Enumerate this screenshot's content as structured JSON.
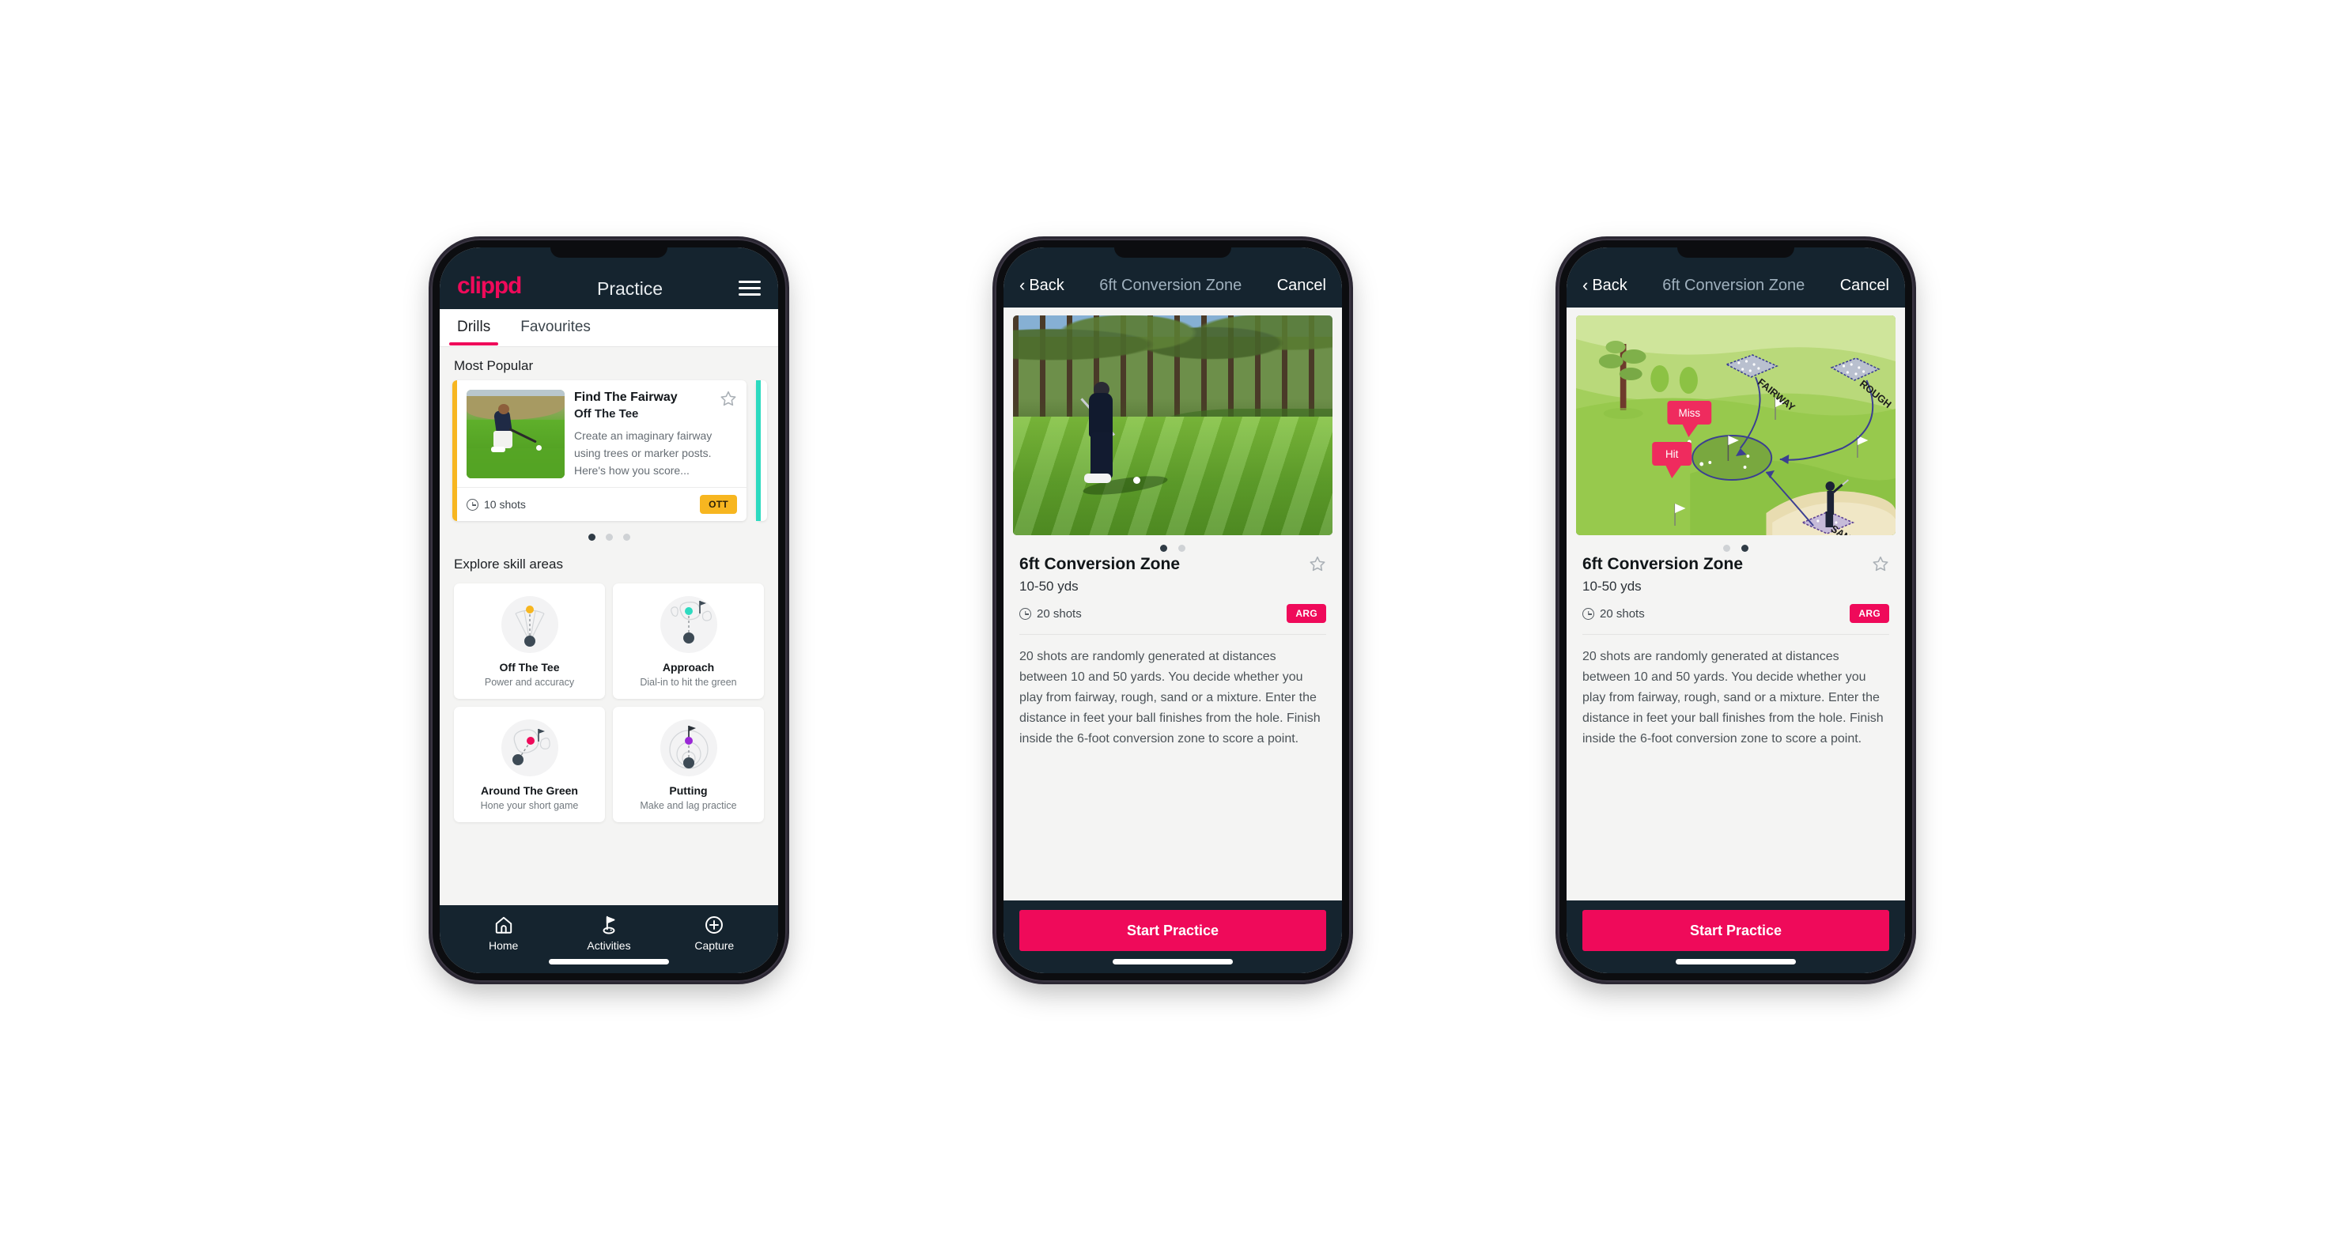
{
  "phone1": {
    "appbar": {
      "brand": "clippd",
      "title": "Practice",
      "menu_icon": "hamburger-menu-icon"
    },
    "tabs": [
      {
        "label": "Drills",
        "active": true
      },
      {
        "label": "Favourites",
        "active": false
      }
    ],
    "section_title": "Most Popular",
    "drill_card": {
      "name": "Find The Fairway",
      "category": "Off The Tee",
      "description": "Create an imaginary fairway using trees or marker posts. Here's how you score...",
      "shots": "10 shots",
      "pill": "OTT",
      "accent_color": "#f7b620",
      "next_accent_color": "#2ddac0",
      "star_icon": "star-outline-icon",
      "clock_icon": "clock-icon"
    },
    "carousel_dots": {
      "count": 3,
      "active": 0
    },
    "skills_title": "Explore skill areas",
    "skills": [
      {
        "name": "Off The Tee",
        "sub": "Power and accuracy",
        "icon": "tee-fan-icon",
        "dot_color": "#f7b620"
      },
      {
        "name": "Approach",
        "sub": "Dial-in to hit the green",
        "icon": "approach-green-icon",
        "dot_color": "#2ddac0"
      },
      {
        "name": "Around The Green",
        "sub": "Hone your short game",
        "icon": "around-green-icon",
        "dot_color": "#ef0a5a"
      },
      {
        "name": "Putting",
        "sub": "Make and lag practice",
        "icon": "putting-rings-icon",
        "dot_color": "#9a27d6"
      }
    ],
    "bottom_nav": [
      {
        "label": "Home",
        "icon": "home-icon",
        "active": false
      },
      {
        "label": "Activities",
        "icon": "golf-flag-icon",
        "active": true
      },
      {
        "label": "Capture",
        "icon": "plus-circle-icon",
        "active": false
      }
    ]
  },
  "phone2": {
    "nav": {
      "back": "Back",
      "title": "6ft Conversion Zone",
      "cancel": "Cancel",
      "back_icon": "chevron-left-icon"
    },
    "media_kind": "photo-golfer-chipping",
    "carousel_dots": {
      "count": 2,
      "active": 0
    },
    "detail": {
      "title": "6ft Conversion Zone",
      "distance": "10-50 yds",
      "shots": "20 shots",
      "pill": "ARG",
      "star_icon": "star-outline-icon",
      "clock_icon": "clock-icon",
      "description": "20 shots are randomly generated at distances between 10 and 50 yards. You decide whether you play from fairway, rough, sand or a mixture. Enter the distance in feet your ball finishes from the hole. Finish inside the 6-foot conversion zone to score a point."
    },
    "cta": "Start Practice"
  },
  "phone3": {
    "nav": {
      "back": "Back",
      "title": "6ft Conversion Zone",
      "cancel": "Cancel",
      "back_icon": "chevron-left-icon"
    },
    "media_kind": "diagram-course-map",
    "diagram_labels": {
      "fairway": "FAIRWAY",
      "rough": "ROUGH",
      "sand": "SAND",
      "miss": "Miss",
      "hit": "Hit"
    },
    "carousel_dots": {
      "count": 2,
      "active": 1
    },
    "detail": {
      "title": "6ft Conversion Zone",
      "distance": "10-50 yds",
      "shots": "20 shots",
      "pill": "ARG",
      "star_icon": "star-outline-icon",
      "clock_icon": "clock-icon",
      "description": "20 shots are randomly generated at distances between 10 and 50 yards. You decide whether you play from fairway, rough, sand or a mixture. Enter the distance in feet your ball finishes from the hole. Finish inside the 6-foot conversion zone to score a point."
    },
    "cta": "Start Practice"
  },
  "colors": {
    "brand_pink": "#ef0a5a",
    "dark_navy": "#15242f",
    "yellow": "#f7b620",
    "teal": "#2ddac0",
    "purple": "#9a27d6",
    "page_bg": "#ffffff"
  }
}
